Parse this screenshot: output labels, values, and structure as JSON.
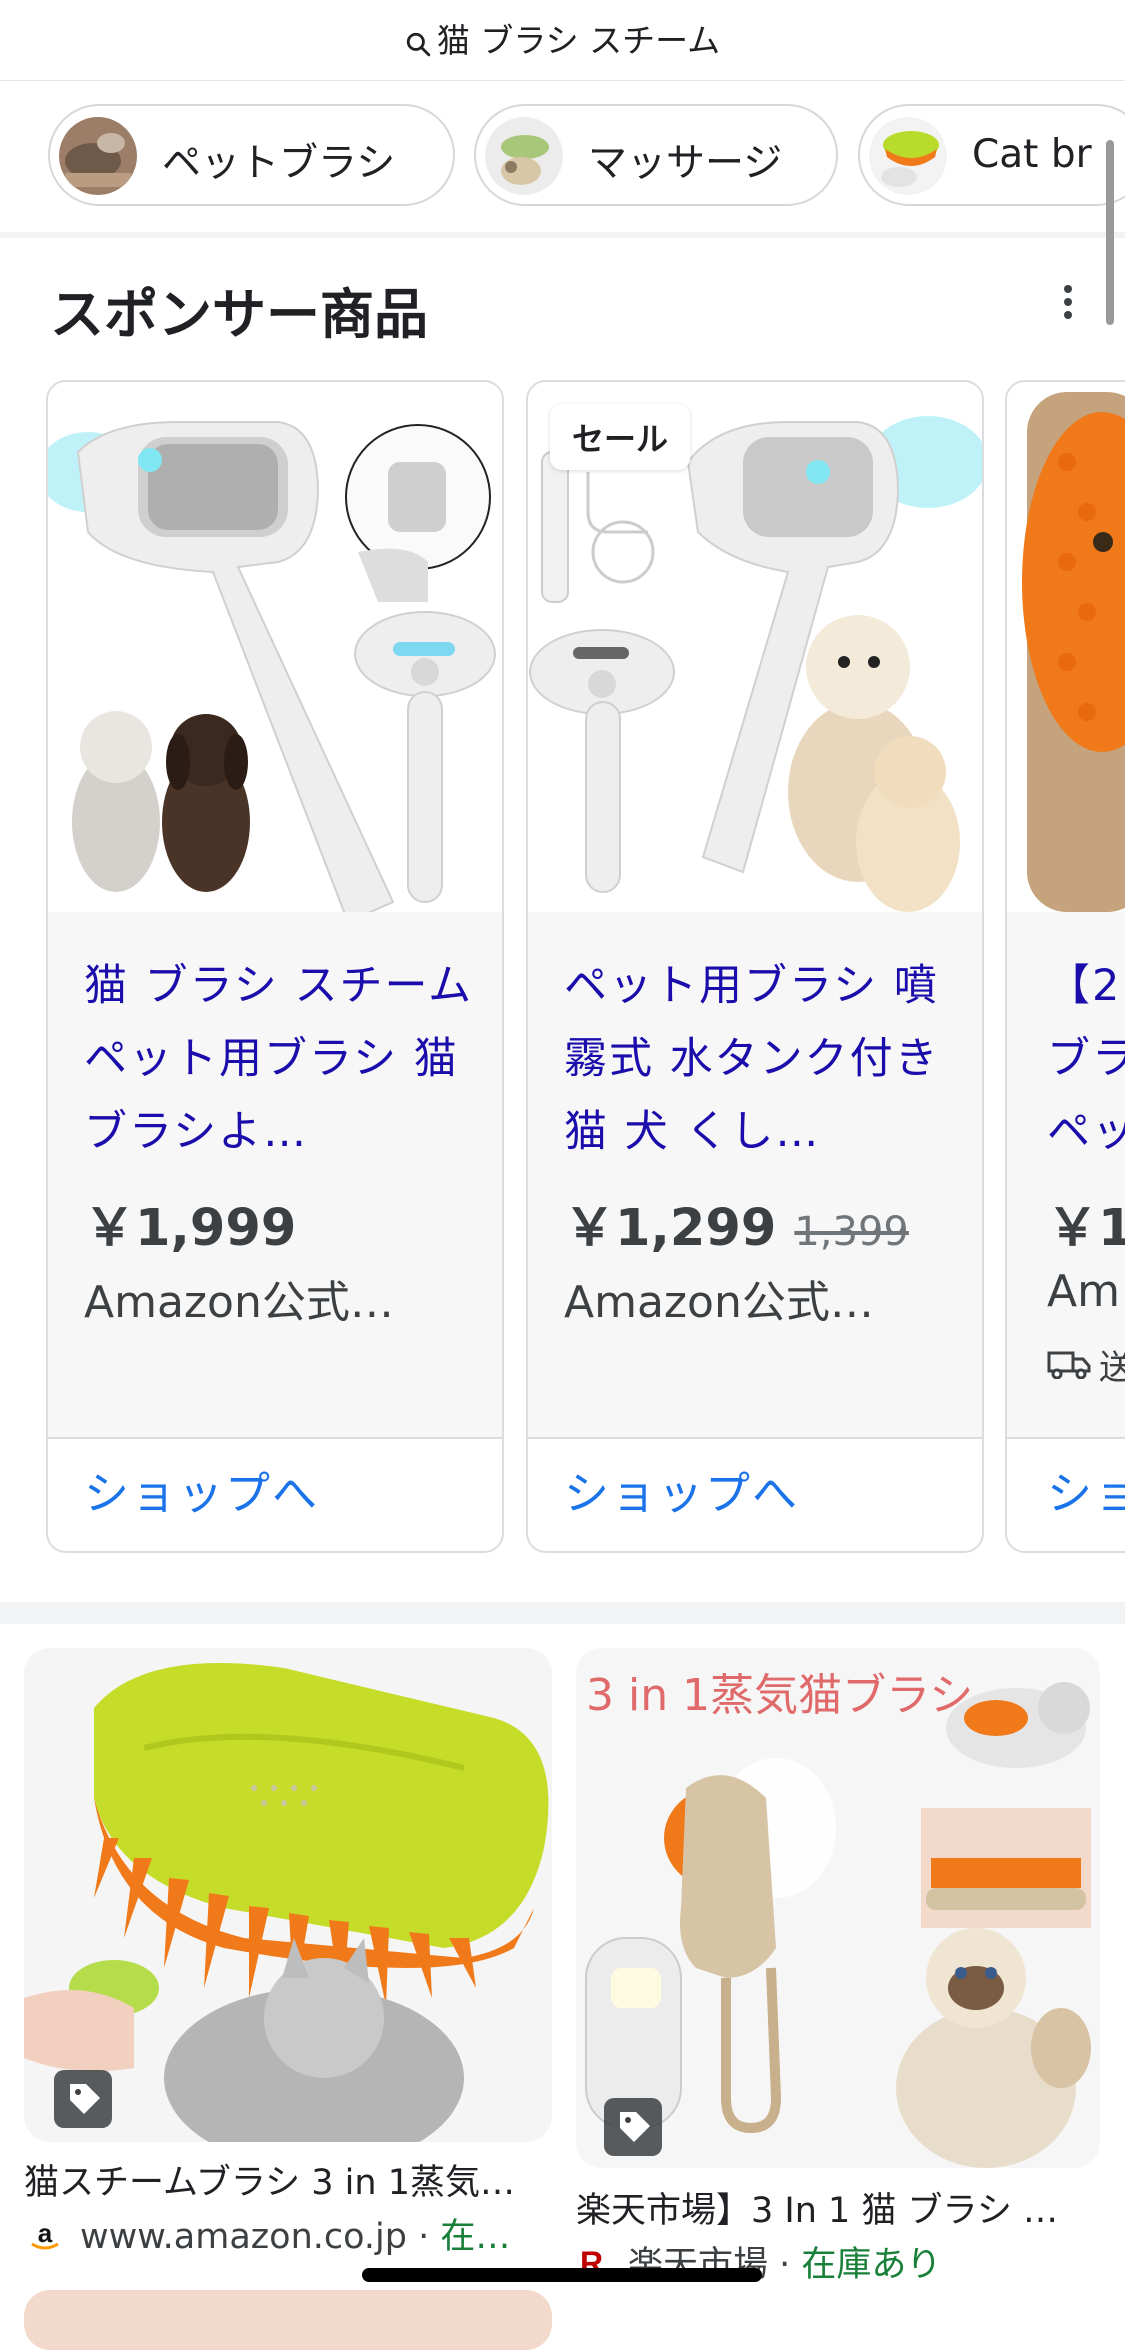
{
  "search": {
    "query": "猫 ブラシ スチーム"
  },
  "chips": [
    {
      "label": "ペットブラシ"
    },
    {
      "label": "マッサージ"
    },
    {
      "label": "Cat br"
    }
  ],
  "sponsored": {
    "title": "スポンサー商品"
  },
  "products": [
    {
      "title": "猫 ブラシ スチーム ペット用ブラシ 猫ブラシよ…",
      "price": "￥1,999",
      "old_price": "",
      "seller": "Amazon公式…",
      "shop_label": "ショップへ",
      "badge": ""
    },
    {
      "title": "ペット用ブラシ 噴霧式 水タンク付き 猫 犬 くし…",
      "price": "￥1,299",
      "old_price": "1,399",
      "seller": "Amazon公式…",
      "shop_label": "ショップへ",
      "badge": "セール"
    },
    {
      "title": "【2 ブラ ペッ",
      "price": "￥1",
      "old_price": "",
      "seller": "Am",
      "shipping": "送",
      "shop_label": "ショ",
      "badge": ""
    }
  ],
  "image_results": [
    {
      "title": "猫スチームブラシ 3 in 1蒸気…",
      "source": "www.amazon.co.jp",
      "separator": " · ",
      "stock": "在…"
    },
    {
      "title": "楽天市場】3 In 1 猫 ブラシ …",
      "source": "楽天市場",
      "separator": " · ",
      "stock": "在庫あり",
      "image_text": "3 in 1蒸気猫ブラシ"
    }
  ],
  "colors": {
    "link": "#1a0dab",
    "shop": "#1a73e8",
    "stock": "#188038",
    "brush_orange": "#f07a1a",
    "brush_green": "#c8e02a"
  }
}
